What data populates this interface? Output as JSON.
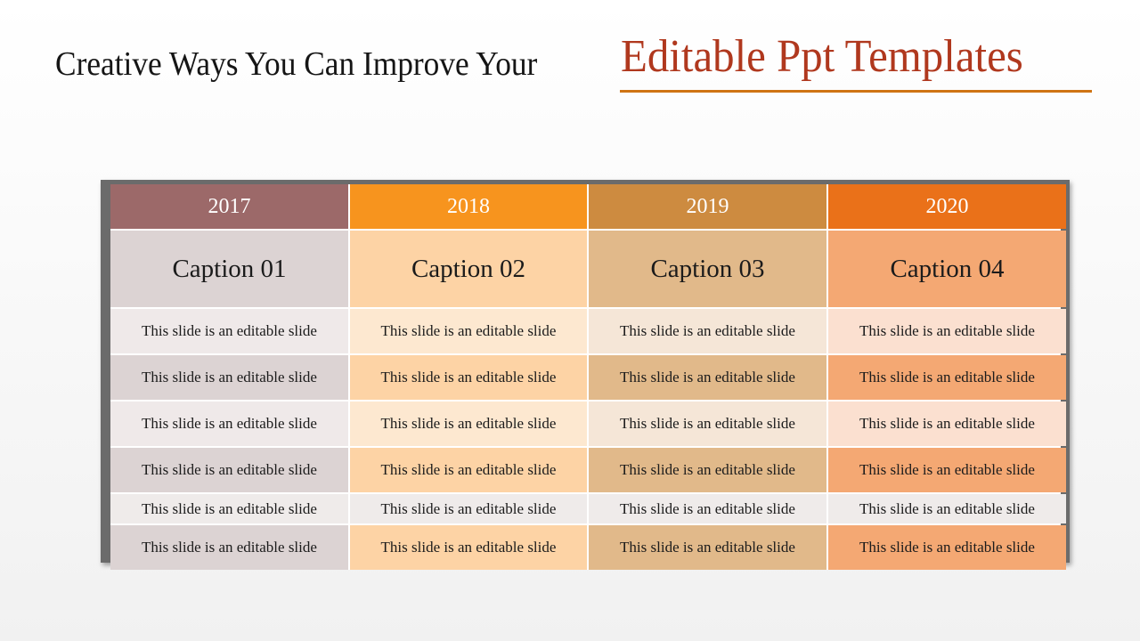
{
  "title": {
    "prefix": "Creative Ways You Can Improve Your",
    "highlight": "Editable Ppt Templates"
  },
  "colors": {
    "title_text": "#151515",
    "highlight_text": "#b0381e",
    "underline": "#cf7414",
    "header_text": "#ffffff"
  },
  "table": {
    "columns": [
      {
        "year": "2017",
        "caption": "Caption 01",
        "header_color": "#9c6969",
        "caption_color": "#dcd3d3",
        "light_color": "#efe9e9",
        "dark_color": "#dcd3d3"
      },
      {
        "year": "2018",
        "caption": "Caption 02",
        "header_color": "#f7941e",
        "caption_color": "#fdd3a5",
        "light_color": "#fde8d0",
        "dark_color": "#fdd3a5"
      },
      {
        "year": "2019",
        "caption": "Caption 03",
        "header_color": "#cd8b40",
        "caption_color": "#e1b98a",
        "light_color": "#f5e6d7",
        "dark_color": "#e1b98a"
      },
      {
        "year": "2020",
        "caption": "Caption 04",
        "header_color": "#ea7119",
        "caption_color": "#f4a873",
        "light_color": "#fbe0d0",
        "dark_color": "#f4a873"
      }
    ],
    "rows": [
      {
        "style": "light",
        "cells": [
          "This slide is an editable slide",
          "This slide is an editable slide",
          "This slide is an editable slide",
          "This slide is an editable slide"
        ]
      },
      {
        "style": "dark",
        "cells": [
          "This slide is an editable slide",
          "This slide is an editable slide",
          "This slide is an editable slide",
          "This slide is an editable slide"
        ]
      },
      {
        "style": "light",
        "cells": [
          "This slide is an editable slide",
          "This slide is an editable slide",
          "This slide is an editable slide",
          "This slide is an editable slide"
        ]
      },
      {
        "style": "dark",
        "cells": [
          "This slide is an editable slide",
          "This slide is an editable slide",
          "This slide is an editable slide",
          "This slide is an editable slide"
        ]
      },
      {
        "style": "neutral",
        "cells": [
          "This slide is an editable slide",
          "This slide is an editable slide",
          "This slide is an editable slide",
          "This slide is an editable slide"
        ]
      },
      {
        "style": "dark",
        "cells": [
          "This slide is an editable slide",
          "This slide is an editable slide",
          "This slide is an editable slide",
          "This slide is an editable slide"
        ]
      }
    ],
    "neutral_color": "#efebea"
  }
}
